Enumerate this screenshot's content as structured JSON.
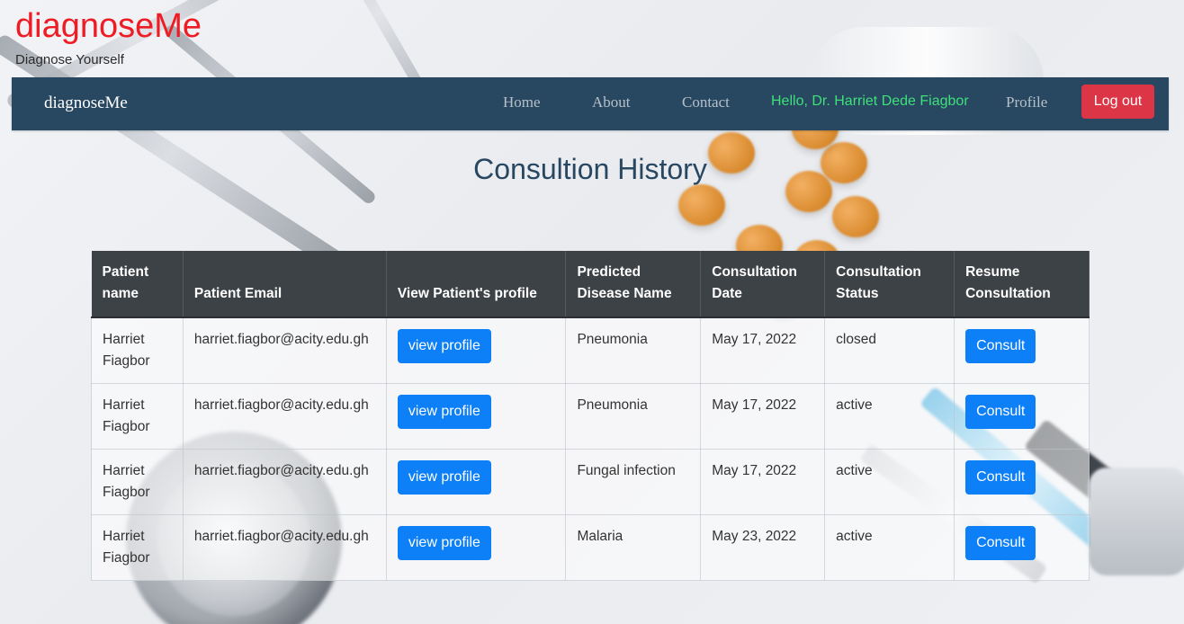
{
  "brand": {
    "title": "diagnoseMe",
    "tagline": "Diagnose Yourself"
  },
  "navbar": {
    "brand": "diagnoseMe",
    "links": [
      "Home",
      "About",
      "Contact"
    ],
    "greeting": "Hello, Dr. Harriet Dede Fiagbor",
    "profile": "Profile",
    "logout": "Log out"
  },
  "page_title": "Consultion History",
  "table": {
    "headers": [
      "Patient name",
      "Patient Email",
      "View Patient's profile",
      "Predicted Disease Name",
      "Consultation Date",
      "Consultation Status",
      "Resume Consultation"
    ],
    "view_label": "view profile",
    "consult_label": "Consult",
    "rows": [
      {
        "name": "Harriet Fiagbor",
        "email": "harriet.fiagbor@acity.edu.gh",
        "disease": "Pneumonia",
        "date": "May 17, 2022",
        "status": "closed"
      },
      {
        "name": "Harriet Fiagbor",
        "email": "harriet.fiagbor@acity.edu.gh",
        "disease": "Pneumonia",
        "date": "May 17, 2022",
        "status": "active"
      },
      {
        "name": "Harriet Fiagbor",
        "email": "harriet.fiagbor@acity.edu.gh",
        "disease": "Fungal infection",
        "date": "May 17, 2022",
        "status": "active"
      },
      {
        "name": "Harriet Fiagbor",
        "email": "harriet.fiagbor@acity.edu.gh",
        "disease": "Malaria",
        "date": "May 23, 2022",
        "status": "active"
      }
    ]
  },
  "colors": {
    "brand_red": "#ee1c24",
    "navbar": "#284761",
    "greeting": "#3fe07a",
    "logout": "#dc3545",
    "button_blue": "#0d7ff7",
    "table_head": "#3d4247"
  }
}
